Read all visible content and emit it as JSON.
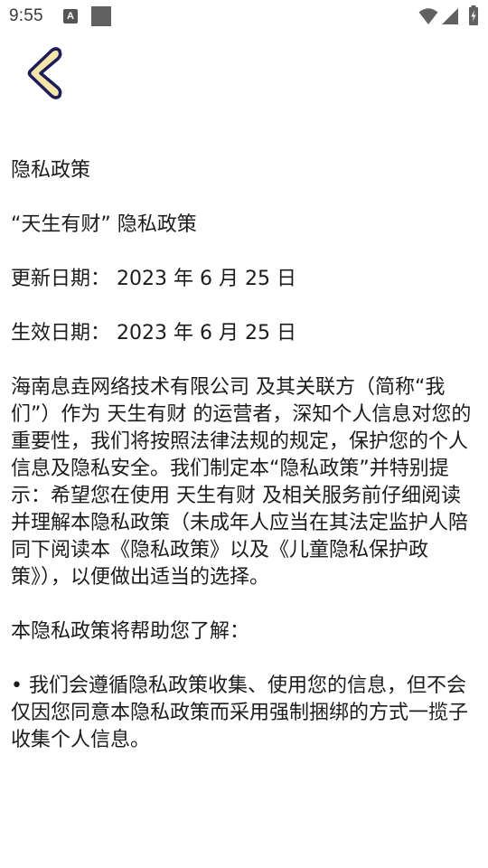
{
  "status_bar": {
    "time": "9:55",
    "notification_letter": "A",
    "icons": [
      "a-notification-icon",
      "square-notification-icon",
      "wifi-icon",
      "signal-icon",
      "battery-charging-icon"
    ]
  },
  "toolbar": {
    "back_icon": "chevron-left-icon",
    "back_color": "#1d1d5a",
    "back_fill": "#f6e5a8"
  },
  "policy": {
    "heading": "隐私政策",
    "title": "“天生有财” 隐私政策",
    "updated": "更新日期： 2023 年 6 月 25 日",
    "effective": "生效日期： 2023 年 6 月 25 日",
    "intro": "海南息垚网络技术有限公司 及其关联方（简称“我们”）作为 天生有财 的运营者，深知个人信息对您的重要性，我们将按照法律法规的规定，保护您的个人信息及隐私安全。我们制定本“隐私政策”并特别提示：希望您在使用 天生有财 及相关服务前仔细阅读并理解本隐私政策（未成年人应当在其法定监护人陪同下阅读本《隐私政策》以及《儿童隐私保护政策》），以便做出适当的选择。",
    "help_heading": "本隐私政策将帮助您了解：",
    "bullet_1": "• 我们会遵循隐私政策收集、使用您的信息，但不会仅因您同意本隐私政策而采用强制捆绑的方式一揽子收集个人信息。"
  }
}
